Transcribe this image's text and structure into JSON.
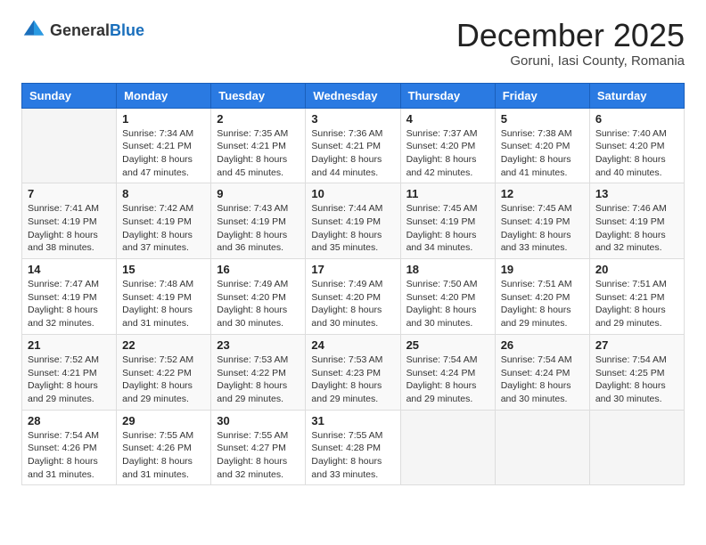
{
  "logo": {
    "general": "General",
    "blue": "Blue"
  },
  "header": {
    "month": "December 2025",
    "location": "Goruni, Iasi County, Romania"
  },
  "days_of_week": [
    "Sunday",
    "Monday",
    "Tuesday",
    "Wednesday",
    "Thursday",
    "Friday",
    "Saturday"
  ],
  "weeks": [
    [
      {
        "day": "",
        "info": ""
      },
      {
        "day": "1",
        "info": "Sunrise: 7:34 AM\nSunset: 4:21 PM\nDaylight: 8 hours\nand 47 minutes."
      },
      {
        "day": "2",
        "info": "Sunrise: 7:35 AM\nSunset: 4:21 PM\nDaylight: 8 hours\nand 45 minutes."
      },
      {
        "day": "3",
        "info": "Sunrise: 7:36 AM\nSunset: 4:21 PM\nDaylight: 8 hours\nand 44 minutes."
      },
      {
        "day": "4",
        "info": "Sunrise: 7:37 AM\nSunset: 4:20 PM\nDaylight: 8 hours\nand 42 minutes."
      },
      {
        "day": "5",
        "info": "Sunrise: 7:38 AM\nSunset: 4:20 PM\nDaylight: 8 hours\nand 41 minutes."
      },
      {
        "day": "6",
        "info": "Sunrise: 7:40 AM\nSunset: 4:20 PM\nDaylight: 8 hours\nand 40 minutes."
      }
    ],
    [
      {
        "day": "7",
        "info": "Sunrise: 7:41 AM\nSunset: 4:19 PM\nDaylight: 8 hours\nand 38 minutes."
      },
      {
        "day": "8",
        "info": "Sunrise: 7:42 AM\nSunset: 4:19 PM\nDaylight: 8 hours\nand 37 minutes."
      },
      {
        "day": "9",
        "info": "Sunrise: 7:43 AM\nSunset: 4:19 PM\nDaylight: 8 hours\nand 36 minutes."
      },
      {
        "day": "10",
        "info": "Sunrise: 7:44 AM\nSunset: 4:19 PM\nDaylight: 8 hours\nand 35 minutes."
      },
      {
        "day": "11",
        "info": "Sunrise: 7:45 AM\nSunset: 4:19 PM\nDaylight: 8 hours\nand 34 minutes."
      },
      {
        "day": "12",
        "info": "Sunrise: 7:45 AM\nSunset: 4:19 PM\nDaylight: 8 hours\nand 33 minutes."
      },
      {
        "day": "13",
        "info": "Sunrise: 7:46 AM\nSunset: 4:19 PM\nDaylight: 8 hours\nand 32 minutes."
      }
    ],
    [
      {
        "day": "14",
        "info": "Sunrise: 7:47 AM\nSunset: 4:19 PM\nDaylight: 8 hours\nand 32 minutes."
      },
      {
        "day": "15",
        "info": "Sunrise: 7:48 AM\nSunset: 4:19 PM\nDaylight: 8 hours\nand 31 minutes."
      },
      {
        "day": "16",
        "info": "Sunrise: 7:49 AM\nSunset: 4:20 PM\nDaylight: 8 hours\nand 30 minutes."
      },
      {
        "day": "17",
        "info": "Sunrise: 7:49 AM\nSunset: 4:20 PM\nDaylight: 8 hours\nand 30 minutes."
      },
      {
        "day": "18",
        "info": "Sunrise: 7:50 AM\nSunset: 4:20 PM\nDaylight: 8 hours\nand 30 minutes."
      },
      {
        "day": "19",
        "info": "Sunrise: 7:51 AM\nSunset: 4:20 PM\nDaylight: 8 hours\nand 29 minutes."
      },
      {
        "day": "20",
        "info": "Sunrise: 7:51 AM\nSunset: 4:21 PM\nDaylight: 8 hours\nand 29 minutes."
      }
    ],
    [
      {
        "day": "21",
        "info": "Sunrise: 7:52 AM\nSunset: 4:21 PM\nDaylight: 8 hours\nand 29 minutes."
      },
      {
        "day": "22",
        "info": "Sunrise: 7:52 AM\nSunset: 4:22 PM\nDaylight: 8 hours\nand 29 minutes."
      },
      {
        "day": "23",
        "info": "Sunrise: 7:53 AM\nSunset: 4:22 PM\nDaylight: 8 hours\nand 29 minutes."
      },
      {
        "day": "24",
        "info": "Sunrise: 7:53 AM\nSunset: 4:23 PM\nDaylight: 8 hours\nand 29 minutes."
      },
      {
        "day": "25",
        "info": "Sunrise: 7:54 AM\nSunset: 4:24 PM\nDaylight: 8 hours\nand 29 minutes."
      },
      {
        "day": "26",
        "info": "Sunrise: 7:54 AM\nSunset: 4:24 PM\nDaylight: 8 hours\nand 30 minutes."
      },
      {
        "day": "27",
        "info": "Sunrise: 7:54 AM\nSunset: 4:25 PM\nDaylight: 8 hours\nand 30 minutes."
      }
    ],
    [
      {
        "day": "28",
        "info": "Sunrise: 7:54 AM\nSunset: 4:26 PM\nDaylight: 8 hours\nand 31 minutes."
      },
      {
        "day": "29",
        "info": "Sunrise: 7:55 AM\nSunset: 4:26 PM\nDaylight: 8 hours\nand 31 minutes."
      },
      {
        "day": "30",
        "info": "Sunrise: 7:55 AM\nSunset: 4:27 PM\nDaylight: 8 hours\nand 32 minutes."
      },
      {
        "day": "31",
        "info": "Sunrise: 7:55 AM\nSunset: 4:28 PM\nDaylight: 8 hours\nand 33 minutes."
      },
      {
        "day": "",
        "info": ""
      },
      {
        "day": "",
        "info": ""
      },
      {
        "day": "",
        "info": ""
      }
    ]
  ]
}
